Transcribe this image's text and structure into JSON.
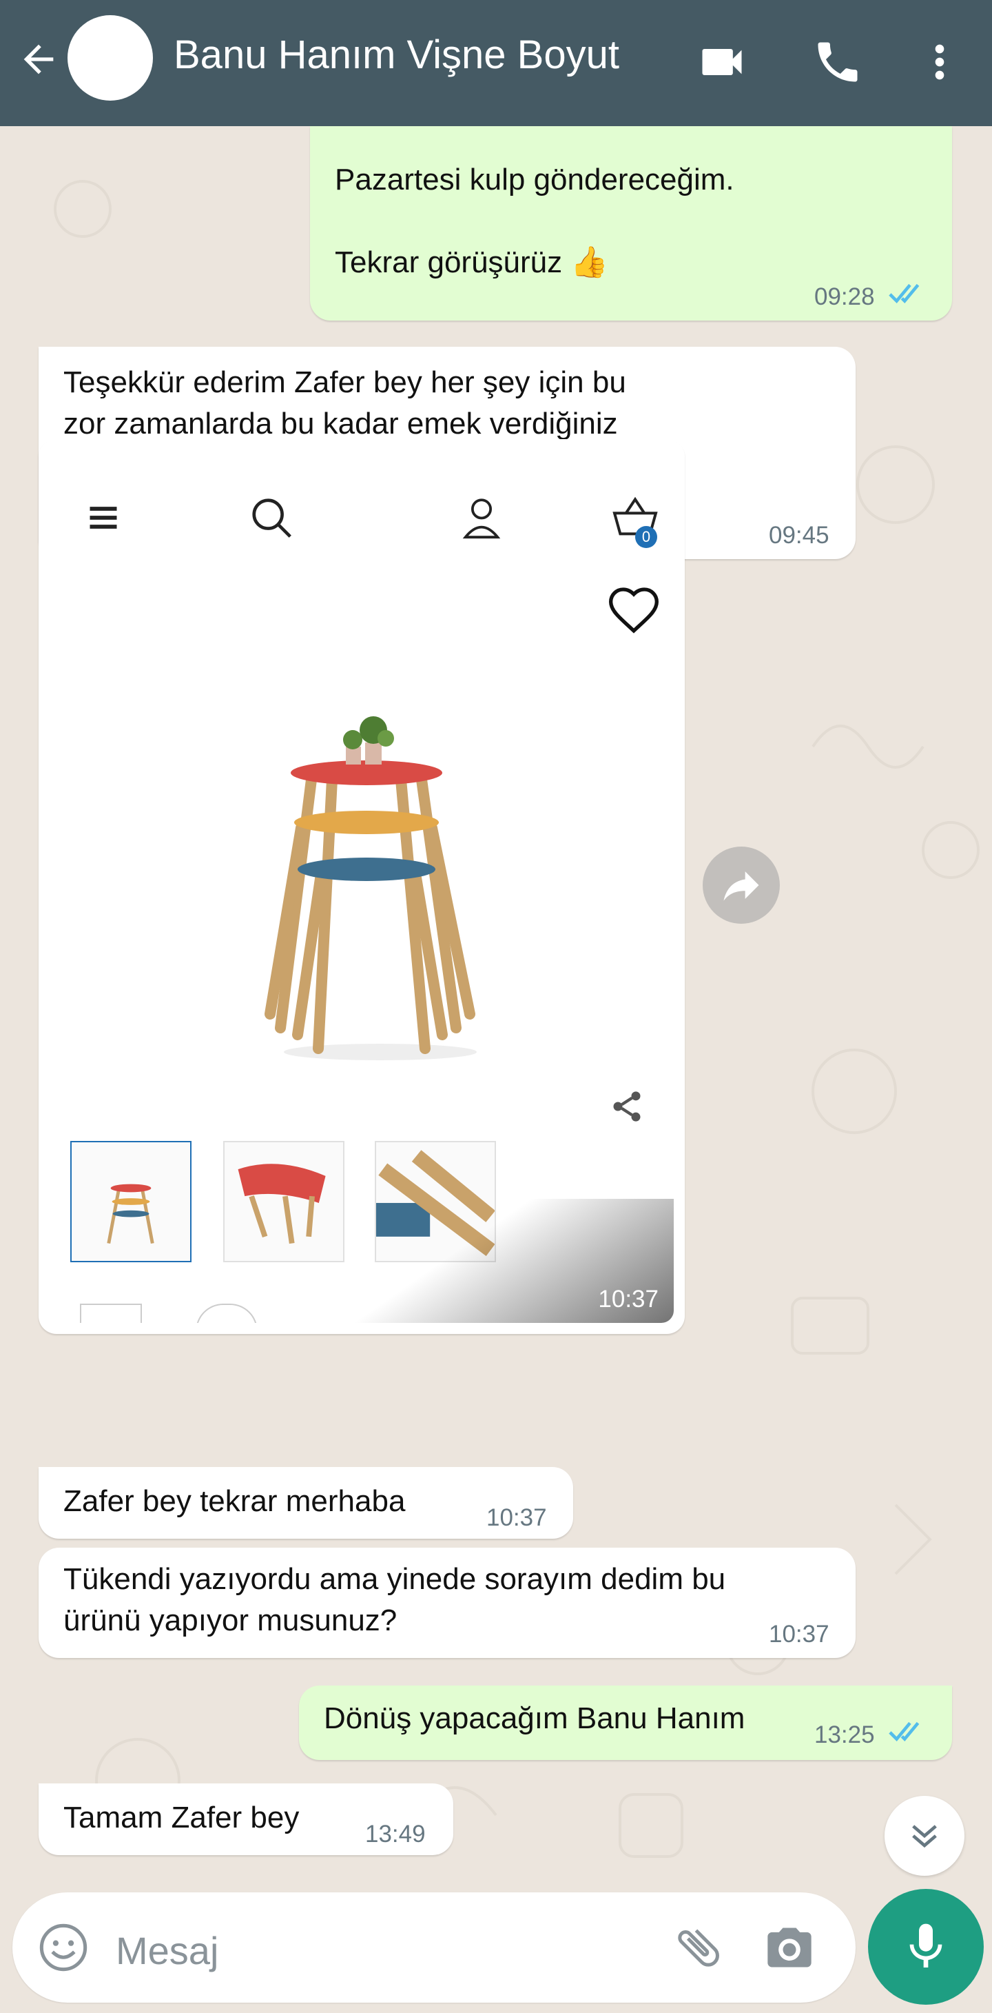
{
  "header": {
    "title": "Banu Hanım Vişne Boyut",
    "icons": [
      "back-arrow-icon",
      "avatar",
      "video-call-icon",
      "phone-icon",
      "more-vert-icon"
    ]
  },
  "messages": [
    {
      "dir": "out",
      "text": "Pazartesi kulp göndereceğim.\n\nTekrar görüşürüz 👍",
      "time": "09:28"
    },
    {
      "dir": "in",
      "text": "Teşekkür ederim Zafer bey her şey için bu\nzor zamanlarda bu kadar emek verdiğiniz\niçin özellikle hakkınızı helal edin daha nice\nalışverişlerde görüşmek üzere 🥰🙋🏻‍♀️",
      "time": "09:45"
    },
    {
      "dir": "in",
      "type": "image",
      "time": "10:37",
      "cart_count": "0"
    },
    {
      "dir": "in",
      "text": "Zafer bey tekrar merhaba",
      "time": "10:37"
    },
    {
      "dir": "in",
      "text": "Tükendi yazıyordu ama yinede sorayım dedim bu\nürünü yapıyor musunuz?",
      "time": "10:37"
    },
    {
      "dir": "out",
      "text": "Dönüş yapacağım Banu Hanım",
      "time": "13:25"
    },
    {
      "dir": "in",
      "text": "Tamam Zafer bey",
      "time": "13:49"
    }
  ],
  "composer": {
    "placeholder": "Mesaj"
  },
  "colors": {
    "header": "#455A64",
    "outgoing": "#E2FDD2",
    "incoming": "#FFFFFF",
    "background": "#ECE5DD",
    "mic": "#1E9E82",
    "read_ticks": "#53BDEB"
  }
}
